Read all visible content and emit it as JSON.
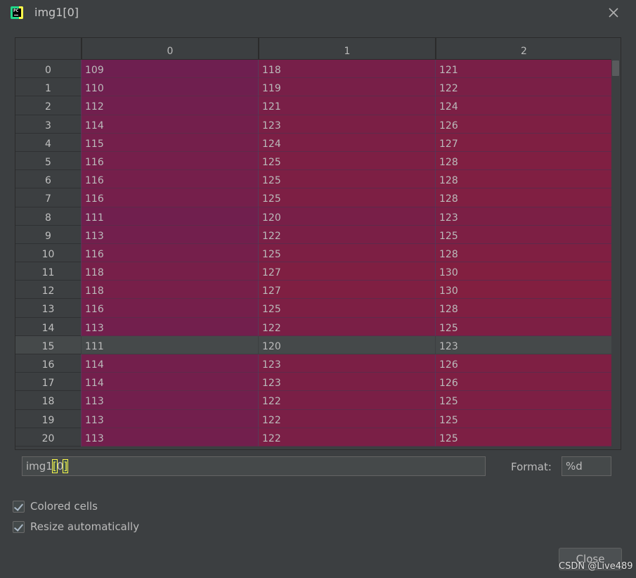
{
  "window": {
    "title": "img1[0]",
    "app_icon": "pycharm-icon",
    "close_icon": "close-icon"
  },
  "table": {
    "columns": [
      "0",
      "1",
      "2"
    ],
    "selected_row_index": 15,
    "rows": [
      {
        "index": "0",
        "values": [
          "109",
          "118",
          "121"
        ]
      },
      {
        "index": "1",
        "values": [
          "110",
          "119",
          "122"
        ]
      },
      {
        "index": "2",
        "values": [
          "112",
          "121",
          "124"
        ]
      },
      {
        "index": "3",
        "values": [
          "114",
          "123",
          "126"
        ]
      },
      {
        "index": "4",
        "values": [
          "115",
          "124",
          "127"
        ]
      },
      {
        "index": "5",
        "values": [
          "116",
          "125",
          "128"
        ]
      },
      {
        "index": "6",
        "values": [
          "116",
          "125",
          "128"
        ]
      },
      {
        "index": "7",
        "values": [
          "116",
          "125",
          "128"
        ]
      },
      {
        "index": "8",
        "values": [
          "111",
          "120",
          "123"
        ]
      },
      {
        "index": "9",
        "values": [
          "113",
          "122",
          "125"
        ]
      },
      {
        "index": "10",
        "values": [
          "116",
          "125",
          "128"
        ]
      },
      {
        "index": "11",
        "values": [
          "118",
          "127",
          "130"
        ]
      },
      {
        "index": "12",
        "values": [
          "118",
          "127",
          "130"
        ]
      },
      {
        "index": "13",
        "values": [
          "116",
          "125",
          "128"
        ]
      },
      {
        "index": "14",
        "values": [
          "113",
          "122",
          "125"
        ]
      },
      {
        "index": "15",
        "values": [
          "111",
          "120",
          "123"
        ]
      },
      {
        "index": "16",
        "values": [
          "114",
          "123",
          "126"
        ]
      },
      {
        "index": "17",
        "values": [
          "114",
          "123",
          "126"
        ]
      },
      {
        "index": "18",
        "values": [
          "113",
          "122",
          "125"
        ]
      },
      {
        "index": "19",
        "values": [
          "113",
          "122",
          "125"
        ]
      },
      {
        "index": "20",
        "values": [
          "113",
          "122",
          "125"
        ]
      }
    ],
    "colors": {
      "cell_low": "#6e1f50",
      "cell_high": "#7e1f44",
      "selected_row": "#45494a"
    }
  },
  "expression": {
    "prefix": "img1",
    "bracket_open": "[",
    "index": "0",
    "bracket_close": "]"
  },
  "format": {
    "label": "Format:",
    "value": "%d"
  },
  "options": {
    "colored_cells": {
      "label": "Colored cells",
      "checked": true
    },
    "resize_automatically": {
      "label": "Resize automatically",
      "checked": true
    }
  },
  "close_button": {
    "label": "Close"
  },
  "watermark": "CSDN @Live489"
}
